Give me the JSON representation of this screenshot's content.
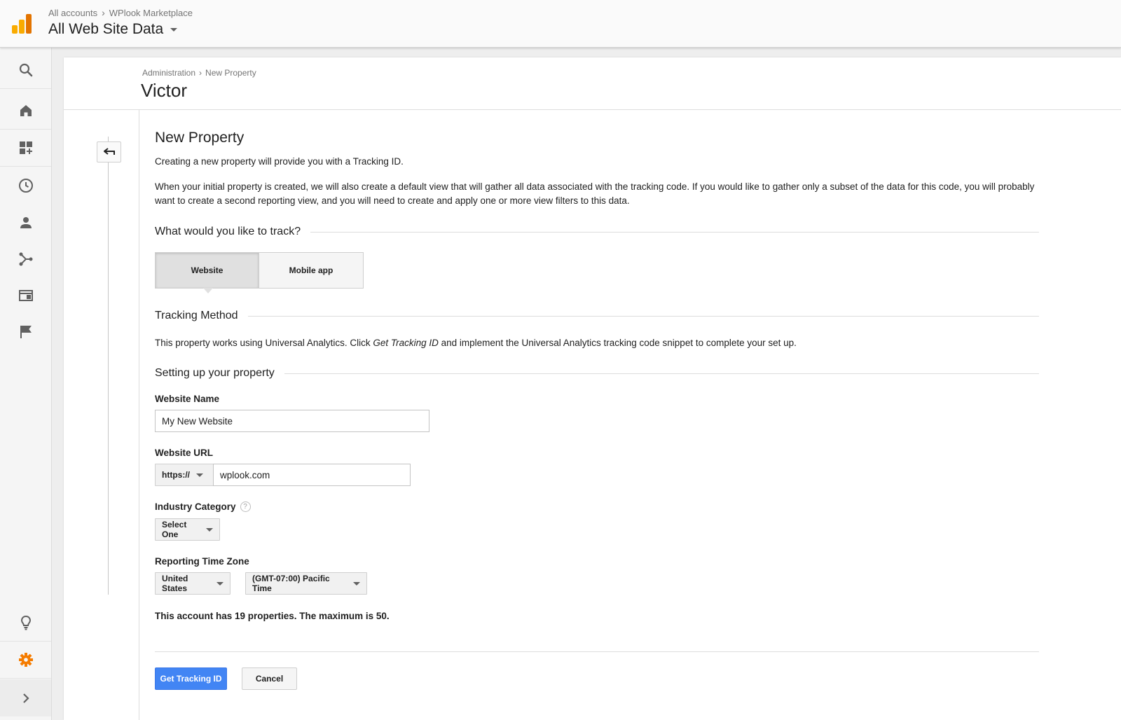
{
  "header": {
    "breadcrumb": [
      "All accounts",
      "WPlook Marketplace"
    ],
    "view_name": "All Web Site Data"
  },
  "rail": {
    "icons": [
      "search-icon",
      "home-icon",
      "dashboard-icon",
      "clock-icon",
      "person-icon",
      "acquisition-icon",
      "behavior-icon",
      "flag-icon",
      "lightbulb-icon",
      "gear-icon",
      "chevron-right-icon"
    ],
    "accent": "#f57c00"
  },
  "page": {
    "breadcrumb": [
      "Administration",
      "New Property"
    ],
    "title": "Victor"
  },
  "form": {
    "heading": "New Property",
    "intro": "Creating a new property will provide you with a Tracking ID.",
    "description": "When your initial property is created, we will also create a default view that will gather all data associated with the tracking code. If you would like to gather only a subset of the data for this code, you will probably want to create a second reporting view, and you will need to create and apply one or more view filters to this data.",
    "track_question": "What would you like to track?",
    "track_options": {
      "website": "Website",
      "mobile_app": "Mobile app",
      "selected": "Website"
    },
    "tracking_method_title": "Tracking Method",
    "tracking_method_text_a": "This property works using Universal Analytics. Click ",
    "tracking_method_link": "Get Tracking ID",
    "tracking_method_text_b": " and implement the Universal Analytics tracking code snippet to complete your set up.",
    "setup_title": "Setting up your property",
    "website_name_label": "Website Name",
    "website_name_value": "My New Website",
    "website_url_label": "Website URL",
    "protocol_value": "https://",
    "website_url_value": "wplook.com",
    "industry_label": "Industry Category",
    "industry_value": "Select One",
    "timezone_label": "Reporting Time Zone",
    "country_value": "United States",
    "timezone_value": "(GMT-07:00) Pacific Time",
    "properties_note": "This account has 19 properties. The maximum is 50.",
    "submit_label": "Get Tracking ID",
    "cancel_label": "Cancel",
    "primary_color": "#4285f4"
  }
}
